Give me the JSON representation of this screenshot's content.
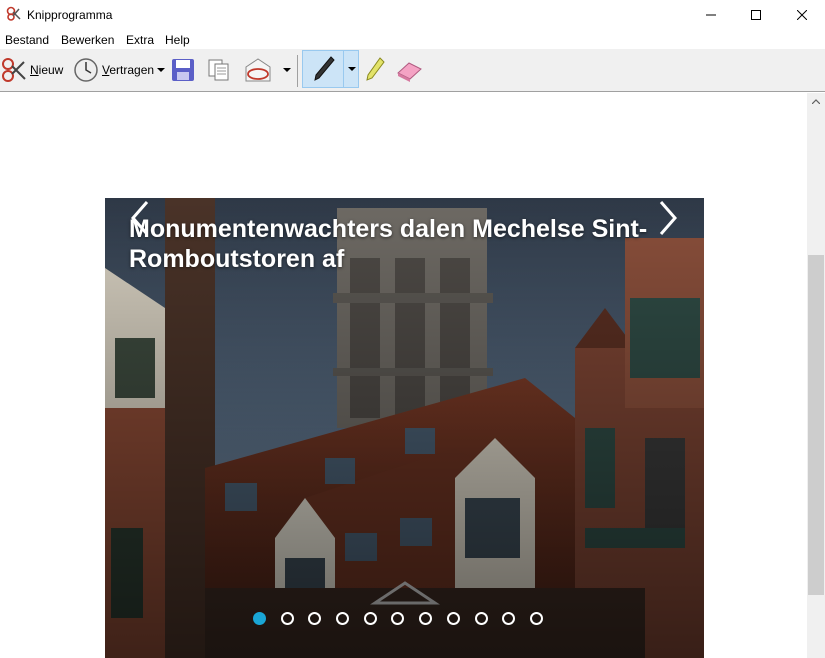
{
  "window": {
    "title": "Knipprogramma",
    "controls": [
      "minimize",
      "maximize",
      "close"
    ]
  },
  "menu": [
    "Bestand",
    "Bewerken",
    "Extra",
    "Help"
  ],
  "toolbar": {
    "new": {
      "label_u": "N",
      "label_rest": "ieuw",
      "icon": "scissors-icon"
    },
    "delay": {
      "label_u": "V",
      "label_rest": "ertragen",
      "icon": "clock-icon"
    },
    "save": {
      "icon": "save-icon"
    },
    "copy": {
      "icon": "copy-icon"
    },
    "send": {
      "icon": "send-email-icon"
    },
    "pen": {
      "icon": "pen-icon",
      "selected": true
    },
    "highlighter": {
      "icon": "highlighter-icon"
    },
    "eraser": {
      "icon": "eraser-icon"
    }
  },
  "content": {
    "headline": "Monumentenwachters dalen Mechelse Sint-Romboutstoren af",
    "slider": {
      "slide_count": 11,
      "active_index": 0,
      "active_color": "#1aa6d6"
    }
  }
}
